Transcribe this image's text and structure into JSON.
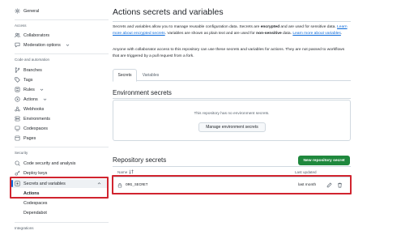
{
  "sidebar": {
    "top_items": [
      {
        "label": "General",
        "icon": "gear-icon"
      }
    ],
    "sections": [
      {
        "title": "Access"
      },
      {
        "title": "Code and automation"
      },
      {
        "title": "Security"
      },
      {
        "title": "Integrations"
      }
    ],
    "access_items": [
      {
        "label": "Collaborators",
        "icon": "people-icon"
      },
      {
        "label": "Moderation options",
        "icon": "comment-icon"
      }
    ],
    "code_items": [
      {
        "label": "Branches",
        "icon": "branch-icon"
      },
      {
        "label": "Tags",
        "icon": "tag-icon"
      },
      {
        "label": "Rules",
        "icon": "rules-icon"
      },
      {
        "label": "Actions",
        "icon": "play-icon"
      },
      {
        "label": "Webhooks",
        "icon": "webhook-icon"
      },
      {
        "label": "Environments",
        "icon": "server-icon"
      },
      {
        "label": "Codespaces",
        "icon": "codespaces-icon"
      },
      {
        "label": "Pages",
        "icon": "browser-icon"
      }
    ],
    "security_items": [
      {
        "label": "Code security and analysis",
        "icon": "codescan-icon"
      },
      {
        "label": "Deploy keys",
        "icon": "key-icon"
      },
      {
        "label": "Secrets and variables",
        "icon": "asterisk-icon"
      }
    ],
    "secrets_sub": [
      {
        "label": "Actions"
      },
      {
        "label": "Codespaces"
      },
      {
        "label": "Dependabot"
      }
    ]
  },
  "main": {
    "title": "Actions secrets and variables",
    "intro": {
      "p1_a": "Secrets and variables allow you to manage reusable configuration data. Secrets are ",
      "p1_b": "encrypted",
      "p1_c": " and are used for sensitive data. ",
      "p1_link1": "Learn more about encrypted secrets",
      "p1_d": ". Variables are shown as plain text and are used for ",
      "p1_e": "non-sensitive",
      "p1_f": " data. ",
      "p1_link2": "Learn more about variables",
      "p1_g": ".",
      "p2": "Anyone with collaborator access to this repository can use these secrets and variables for actions. They are not passed to workflows that are triggered by a pull request from a fork."
    },
    "tabs": [
      {
        "label": "Secrets",
        "active": true
      },
      {
        "label": "Variables",
        "active": false
      }
    ],
    "env_section": {
      "heading": "Environment secrets",
      "empty_message": "This repository has no environment secrets.",
      "button": "Manage environment secrets"
    },
    "repo_section": {
      "heading": "Repository secrets",
      "new_button": "New repository secret",
      "columns": {
        "name": "Name",
        "updated": "Last updated"
      },
      "rows": [
        {
          "name": "ORG_SECRET",
          "updated": "last month"
        }
      ]
    }
  },
  "colors": {
    "accent": "#0969da",
    "primary_button": "#1f883d",
    "highlight_box": "#d1242f"
  }
}
